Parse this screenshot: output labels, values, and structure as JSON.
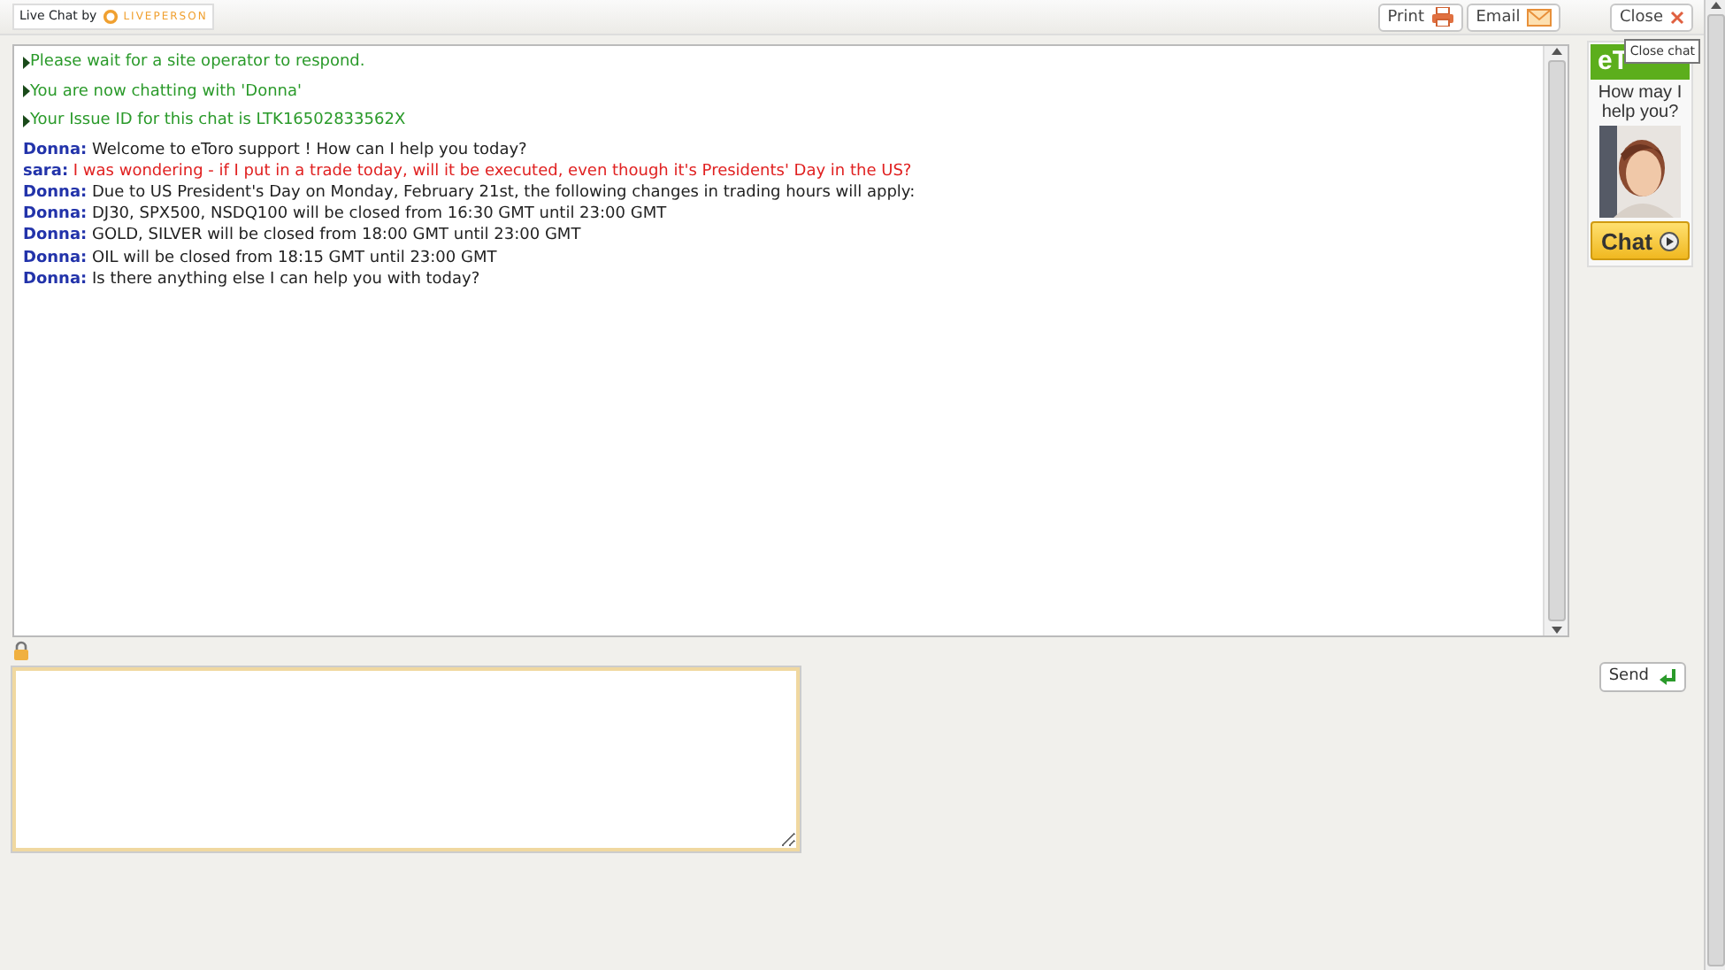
{
  "header": {
    "brand_label": "Live Chat by",
    "brand_name": "LIVEPERSON",
    "buttons": [
      {
        "label": "Print",
        "kind": "print"
      },
      {
        "label": "Email",
        "kind": "email"
      },
      {
        "label": "Close",
        "kind": "close"
      }
    ],
    "tooltip": "Close chat"
  },
  "messages": [
    {
      "kind": "system",
      "text": "Please wait for a site operator to respond."
    },
    {
      "kind": "system",
      "text": "You are now chatting with 'Donna'"
    },
    {
      "kind": "system",
      "text": "Your Issue ID for this chat is LTK16502833562X"
    },
    {
      "kind": "agent",
      "sender": "Donna:",
      "text": "Welcome to eToro support ! How can I help you today?"
    },
    {
      "kind": "visitor",
      "sender": "sara:",
      "text": "I was wondering - if I put in a trade today, will it be executed, even though it's Presidents' Day in the US?"
    },
    {
      "kind": "agent",
      "sender": "Donna:",
      "text": "Due to US President's Day on Monday, February 21st, the following changes in trading hours will apply:"
    },
    {
      "kind": "agent",
      "sender": "Donna:",
      "text": "DJ30, SPX500, NSDQ100 will be closed from 16:30 GMT until 23:00 GMT"
    },
    {
      "kind": "agent",
      "sender": "Donna:",
      "text": "GOLD, SILVER will be closed from 18:00 GMT until 23:00 GMT"
    },
    {
      "kind": "agent",
      "sender": "Donna:",
      "text": "OIL will be closed from 18:15 GMT until 23:00 GMT"
    },
    {
      "kind": "agent",
      "sender": "Donna:",
      "text": "Is there anything else I can help you with today?"
    }
  ],
  "ad": {
    "logo": "eT",
    "headline": "How may I help you?",
    "button": "Chat"
  },
  "composer": {
    "send": "Send"
  }
}
